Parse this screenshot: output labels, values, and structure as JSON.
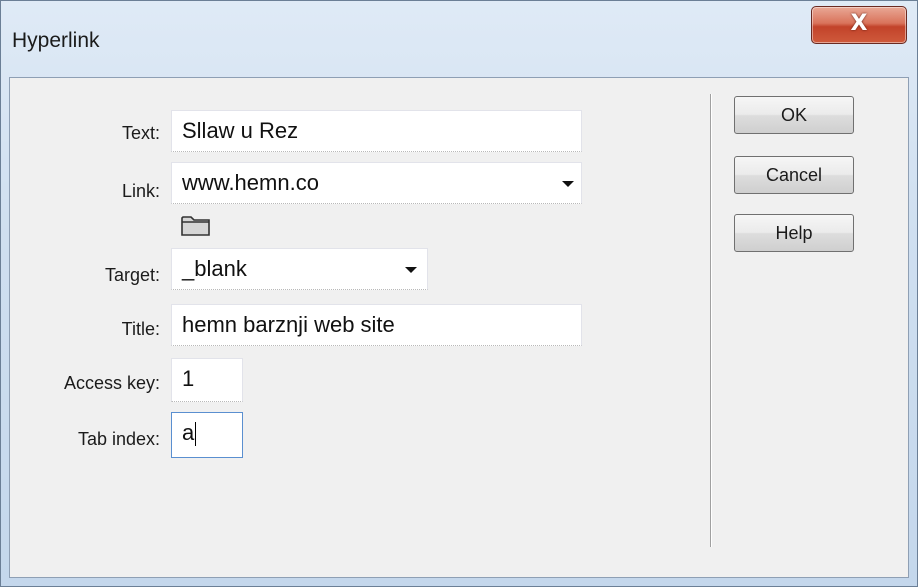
{
  "window": {
    "title": "Hyperlink",
    "close_label": "X"
  },
  "form": {
    "text": {
      "label": "Text:",
      "value": "Sllaw u Rez"
    },
    "link": {
      "label": "Link:",
      "value": "www.hemn.co"
    },
    "target": {
      "label": "Target:",
      "value": "_blank"
    },
    "title": {
      "label": "Title:",
      "value": "hemn barznji web site"
    },
    "access_key": {
      "label": "Access key:",
      "value": "1"
    },
    "tab_index": {
      "label": "Tab index:",
      "value": "a"
    }
  },
  "buttons": {
    "ok": "OK",
    "cancel": "Cancel",
    "help": "Help"
  },
  "icons": {
    "browse": "folder-icon",
    "dropdown": "chevron-down-icon",
    "close": "close-icon"
  }
}
